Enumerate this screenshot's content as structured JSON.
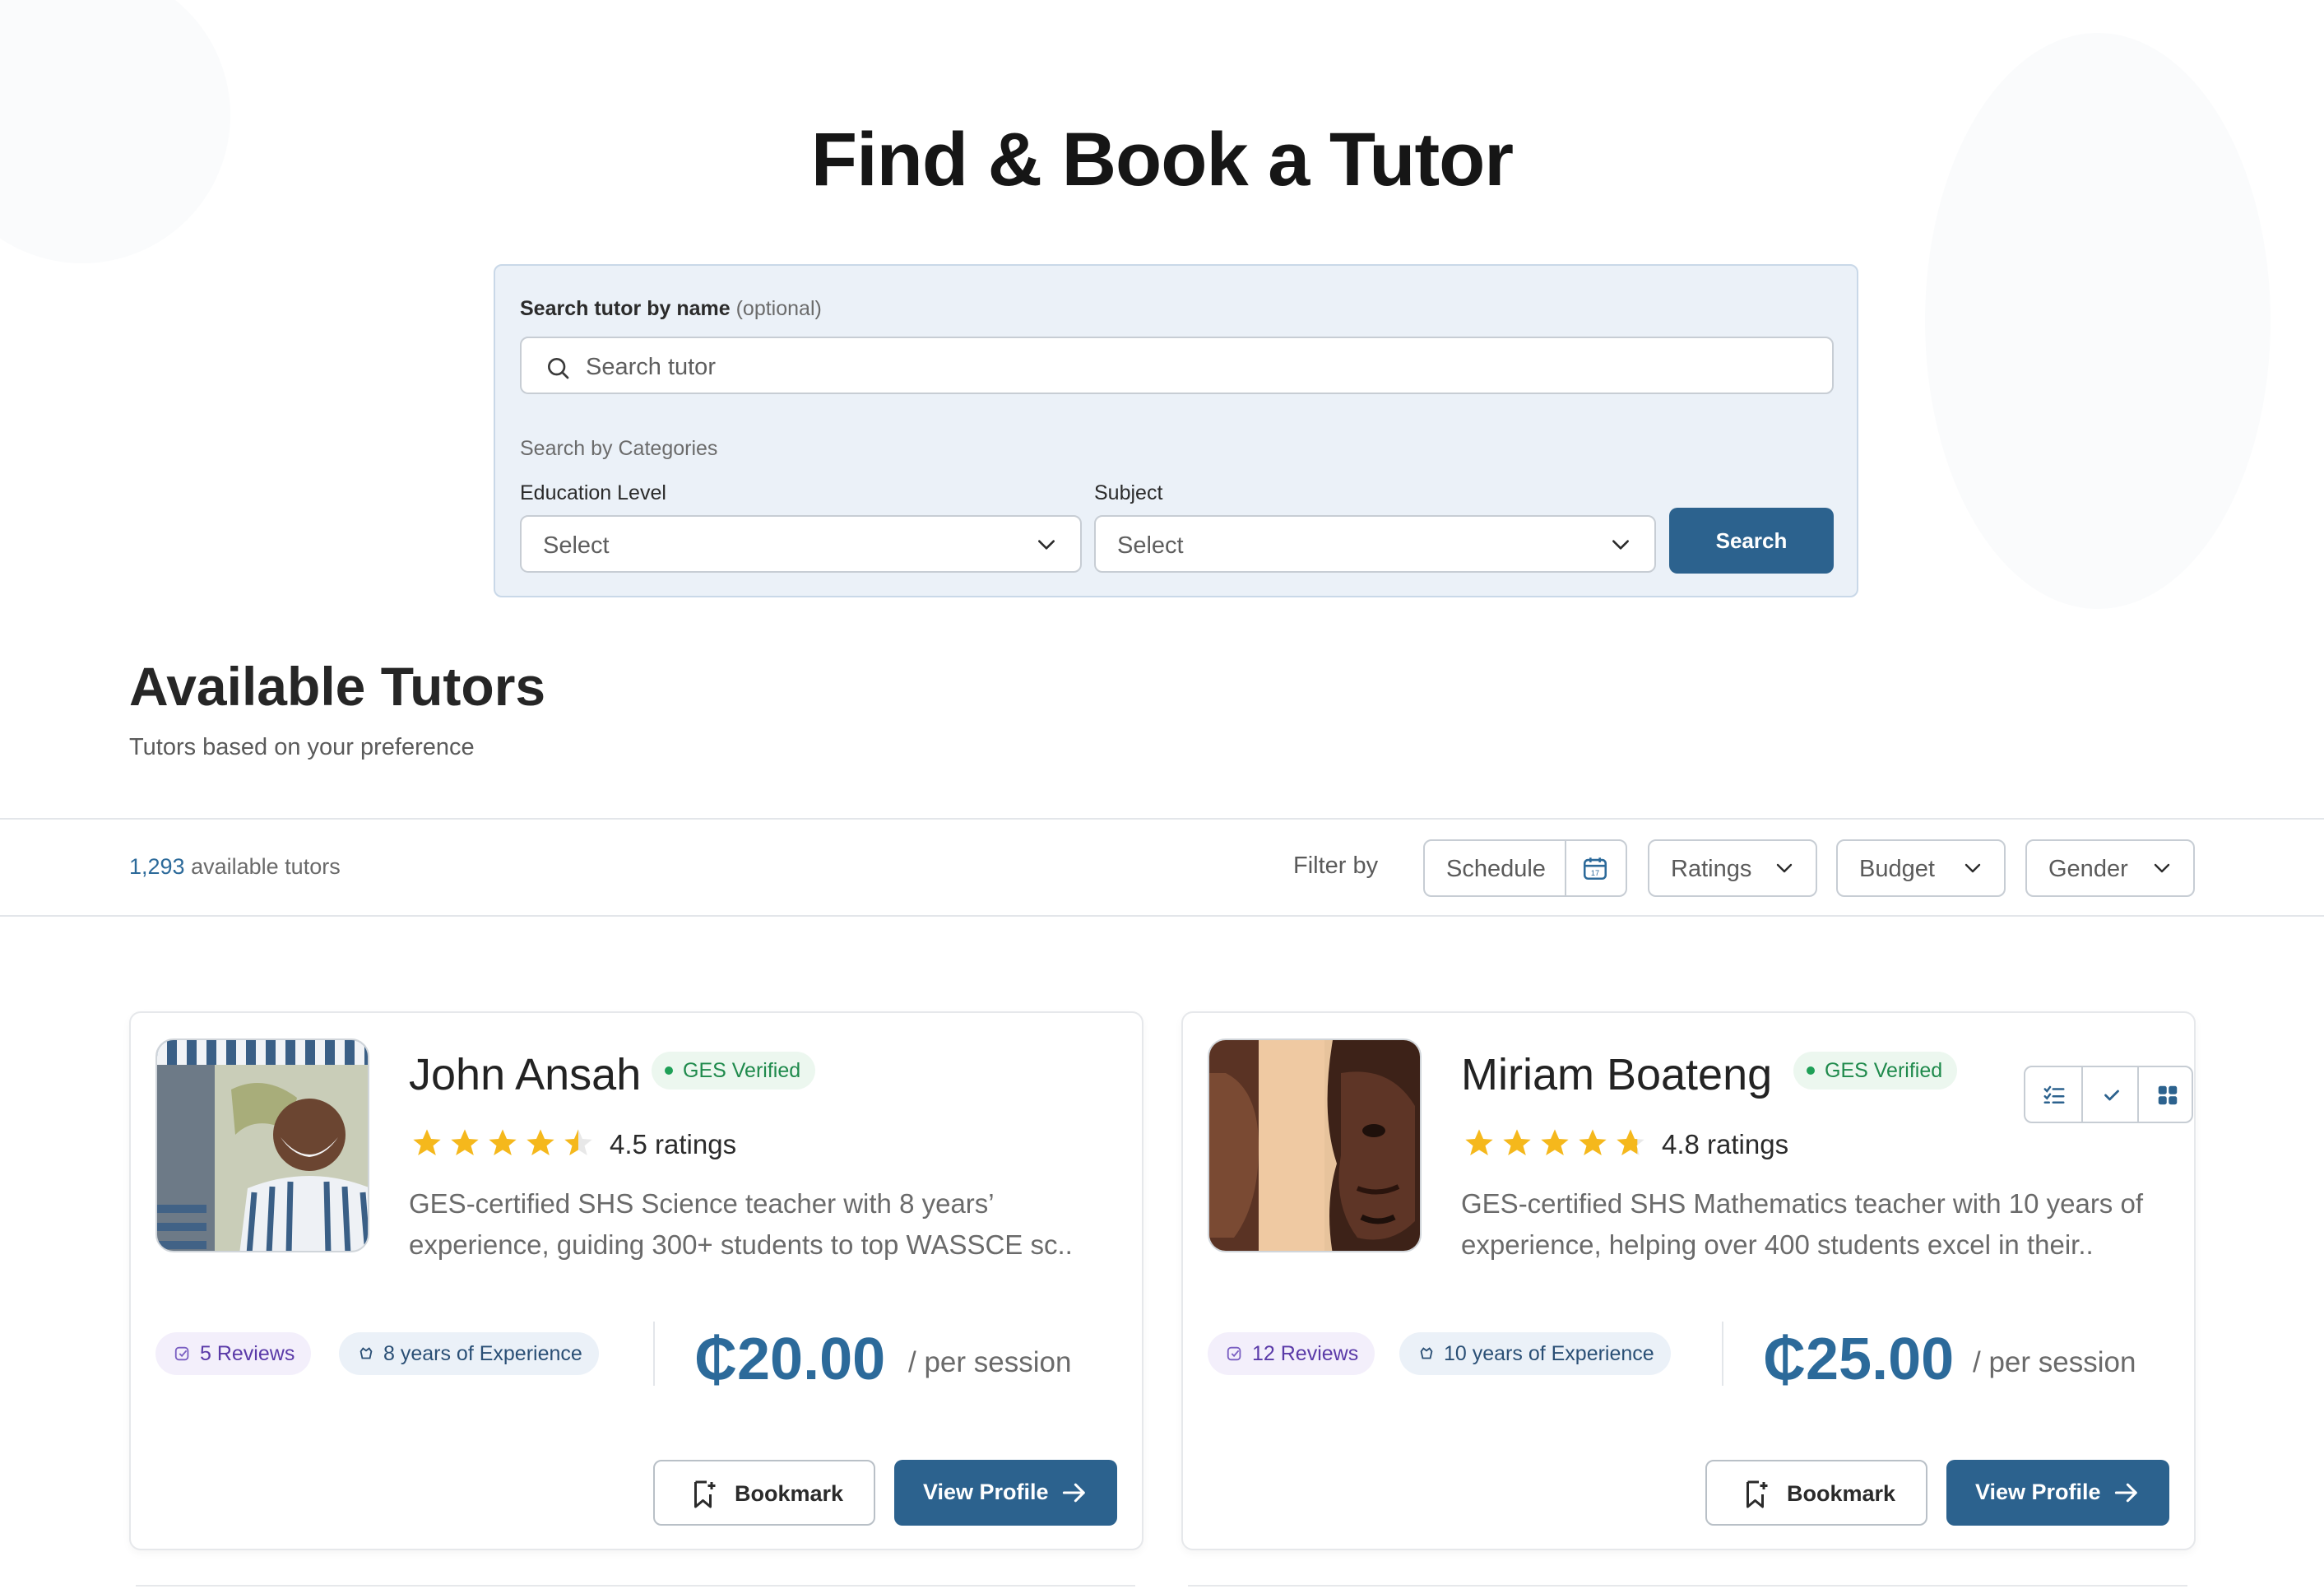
{
  "page": {
    "title": "Find & Book a Tutor"
  },
  "search": {
    "label": "Search tutor by name",
    "label_optional": "(optional)",
    "placeholder": "Search tutor",
    "categories_label": "Search by Categories",
    "education_level": {
      "label": "Education Level",
      "value": "Select"
    },
    "subject": {
      "label": "Subject",
      "value": "Select"
    },
    "button_label": "Search"
  },
  "section": {
    "title": "Available Tutors",
    "subtitle": "Tutors based on your preference"
  },
  "filters": {
    "count": "1,293",
    "count_suffix": "available tutors",
    "filter_by_label": "Filter by",
    "schedule": "Schedule",
    "ratings": "Ratings",
    "budget": "Budget",
    "gender": "Gender"
  },
  "tutors": [
    {
      "name": "John Ansah",
      "verified_label": "GES Verified",
      "rating": 4.5,
      "rating_text": "4.5 ratings",
      "description": "GES-certified SHS Science teacher with 8 years’ experience, guiding 300+ students to top WASSCE sc..",
      "reviews": "5 Reviews",
      "experience": "8 years of Experience",
      "price": "₵20.00",
      "per": "/ per session",
      "bookmark_label": "Bookmark",
      "view_label": "View Profile"
    },
    {
      "name": "Miriam Boateng",
      "verified_label": "GES Verified",
      "rating": 4.8,
      "rating_text": "4.8 ratings",
      "description": "GES-certified SHS Mathematics teacher with 10 years of experience, helping over 400 students excel in their..",
      "reviews": "12 Reviews",
      "experience": "10 years of Experience",
      "price": "₵25.00",
      "per": "/ per session",
      "bookmark_label": "Bookmark",
      "view_label": "View Profile"
    }
  ],
  "colors": {
    "primary": "#2c628e",
    "accent_text": "#2c6a9a",
    "verified": "#1f8a4c",
    "star": "#f5b81c",
    "panel_bg": "#ebf1f8"
  },
  "icons": {
    "search": "search-icon",
    "chevron": "chevron-down-icon",
    "calendar": "calendar-icon",
    "review": "review-icon",
    "experience": "badge-icon",
    "bookmark": "bookmark-icon",
    "arrow": "arrow-right-icon",
    "list_view": "checklist-icon",
    "check": "check-icon",
    "grid_view": "grid-icon"
  }
}
